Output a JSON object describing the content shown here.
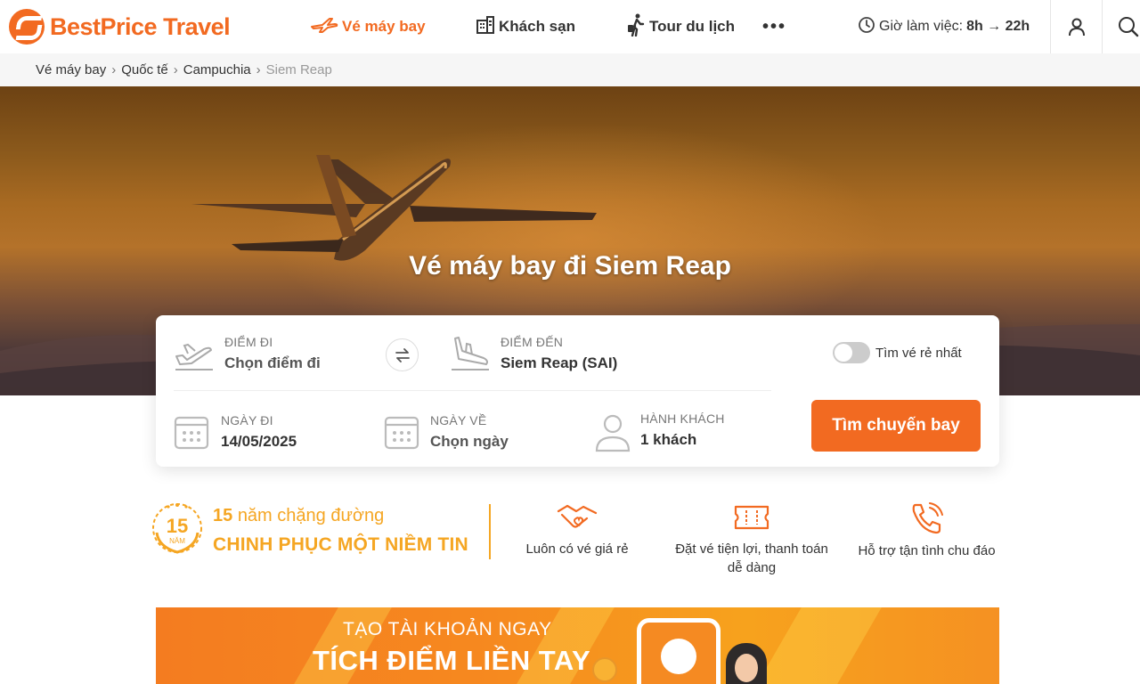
{
  "brand": {
    "name": "BestPrice Travel",
    "color": "#f26a21"
  },
  "nav": {
    "flight": "Vé máy bay",
    "hotel": "Khách sạn",
    "tour": "Tour du lịch",
    "more": "•••"
  },
  "hours": {
    "label": "Giờ làm việc:",
    "value": "8h → 22h"
  },
  "breadcrumb": [
    "Vé máy bay",
    "Quốc tế",
    "Campuchia",
    "Siem Reap"
  ],
  "hero": {
    "title": "Vé máy bay đi Siem Reap"
  },
  "search": {
    "from_label": "Điểm đi",
    "from_value": "Chọn điểm đi",
    "to_label": "Điểm đến",
    "to_value": "Siem Reap (SAI)",
    "cheapest_label": "Tìm vé rẻ nhất",
    "cheapest_on": false,
    "depart_label": "Ngày đi",
    "depart_value": "14/05/2025",
    "return_label": "Ngày về",
    "return_value": "Chọn ngày",
    "pax_label": "Hành khách",
    "pax_value": "1 khách",
    "button": "Tìm chuyến bay"
  },
  "trust": {
    "badge": "15",
    "badge_sub": "NĂM",
    "years": "15",
    "head_rest": "năm chặng đường",
    "sub": "CHINH PHỤC MỘT NIỀM TIN",
    "features": [
      {
        "icon": "handshake-icon",
        "text": "Luôn có vé giá rẻ"
      },
      {
        "icon": "ticket-icon",
        "text": "Đặt vé tiện lợi, thanh toán dễ dàng"
      },
      {
        "icon": "phone-call-icon",
        "text": "Hỗ trợ tận tình chu đáo"
      }
    ]
  },
  "promo": {
    "line1": "TẠO TÀI KHOẢN NGAY",
    "line2": "TÍCH ĐIỂM LIỀN TAY"
  },
  "colors": {
    "accent": "#f26a21",
    "gold": "#f5a623"
  }
}
